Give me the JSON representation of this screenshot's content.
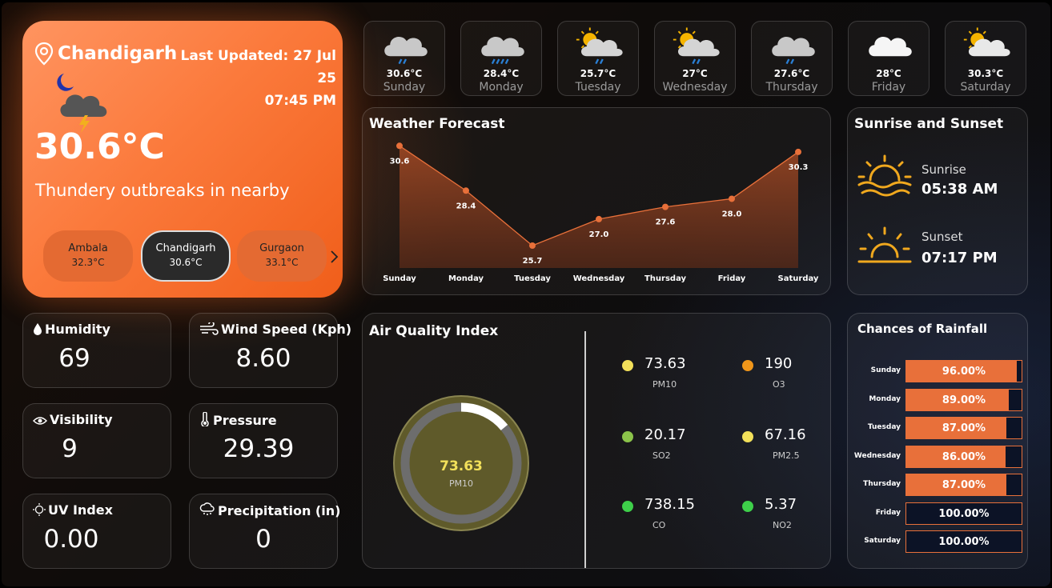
{
  "colors": {
    "accent": "#f06a2a",
    "line": "#e8703a",
    "aqi_ring": "#5f5a2a"
  },
  "main": {
    "city": "Chandigarh",
    "last_updated_line1": "Last Updated: 27 Jul 25",
    "last_updated_line2": "07:45 PM",
    "temperature": "30.6°C",
    "description": "Thundery outbreaks in nearby",
    "weather_icon": "night-thunder-cloud-icon",
    "cities": [
      {
        "name": "Ambala",
        "temp": "32.3°C"
      },
      {
        "name": "Chandigarh",
        "temp": "30.6°C"
      },
      {
        "name": "Gurgaon",
        "temp": "33.1°C"
      }
    ]
  },
  "days": [
    {
      "temp": "30.6°C",
      "name": "Sunday",
      "icon": "light-rain-cloud-icon"
    },
    {
      "temp": "28.4°C",
      "name": "Monday",
      "icon": "heavy-rain-cloud-icon"
    },
    {
      "temp": "25.7°C",
      "name": "Tuesday",
      "icon": "sun-cloud-rain-icon"
    },
    {
      "temp": "27°C",
      "name": "Wednesday",
      "icon": "sun-cloud-rain-icon"
    },
    {
      "temp": "27.6°C",
      "name": "Thursday",
      "icon": "light-rain-cloud-icon"
    },
    {
      "temp": "28°C",
      "name": "Friday",
      "icon": "cloud-icon"
    },
    {
      "temp": "30.3°C",
      "name": "Saturday",
      "icon": "partly-sunny-icon"
    }
  ],
  "forecast": {
    "title": "Weather Forecast"
  },
  "chart_data": {
    "type": "area",
    "title": "Weather Forecast",
    "categories": [
      "Sunday",
      "Monday",
      "Tuesday",
      "Wednesday",
      "Thursday",
      "Friday",
      "Saturday"
    ],
    "values": [
      30.6,
      28.4,
      25.7,
      27.0,
      27.6,
      28.0,
      30.3
    ],
    "labels": [
      "30.6",
      "28.4",
      "25.7",
      "27.0",
      "27.6",
      "28.0",
      "30.3"
    ],
    "ylim": [
      24.6,
      31.2
    ],
    "grid": false,
    "legend": "none"
  },
  "sun": {
    "title": "Sunrise and Sunset",
    "sunrise_label": "Sunrise",
    "sunrise": "05:38 AM",
    "sunset_label": "Sunset",
    "sunset": "07:17 PM"
  },
  "stats": {
    "humidity_label": "Humidity",
    "humidity": "69",
    "wind_label": "Wind Speed (Kph)",
    "wind": "8.60",
    "visibility_label": "Visibility",
    "visibility": "9",
    "pressure_label": "Pressure",
    "pressure": "29.39",
    "uv_label": "UV Index",
    "uv": "0.00",
    "precip_label": "Precipitation (in)",
    "precip": "0"
  },
  "aqi": {
    "title": "Air Quality Index",
    "gauge_value": "73.63",
    "gauge_label": "PM10",
    "gauge_fraction": 0.14,
    "items": [
      {
        "value": "73.63",
        "key": "PM10",
        "color": "#f2e05a"
      },
      {
        "value": "190",
        "key": "O3",
        "color": "#f0961a"
      },
      {
        "value": "20.17",
        "key": "SO2",
        "color": "#8bc34a"
      },
      {
        "value": "67.16",
        "key": "PM2.5",
        "color": "#f2e05a"
      },
      {
        "value": "738.15",
        "key": "CO",
        "color": "#3ecf4a"
      },
      {
        "value": "5.37",
        "key": "NO2",
        "color": "#3ecf4a"
      }
    ]
  },
  "rain": {
    "title": "Chances of Rainfall",
    "rows": [
      {
        "day": "Sunday",
        "label": "96.00%",
        "fill": 0.96
      },
      {
        "day": "Monday",
        "label": "89.00%",
        "fill": 0.89
      },
      {
        "day": "Tuesday",
        "label": "87.00%",
        "fill": 0.87
      },
      {
        "day": "Wednesday",
        "label": "86.00%",
        "fill": 0.86
      },
      {
        "day": "Thursday",
        "label": "87.00%",
        "fill": 0.87
      },
      {
        "day": "Friday",
        "label": "100.00%",
        "fill": 0.0
      },
      {
        "day": "Saturday",
        "label": "100.00%",
        "fill": 0.0
      }
    ]
  }
}
